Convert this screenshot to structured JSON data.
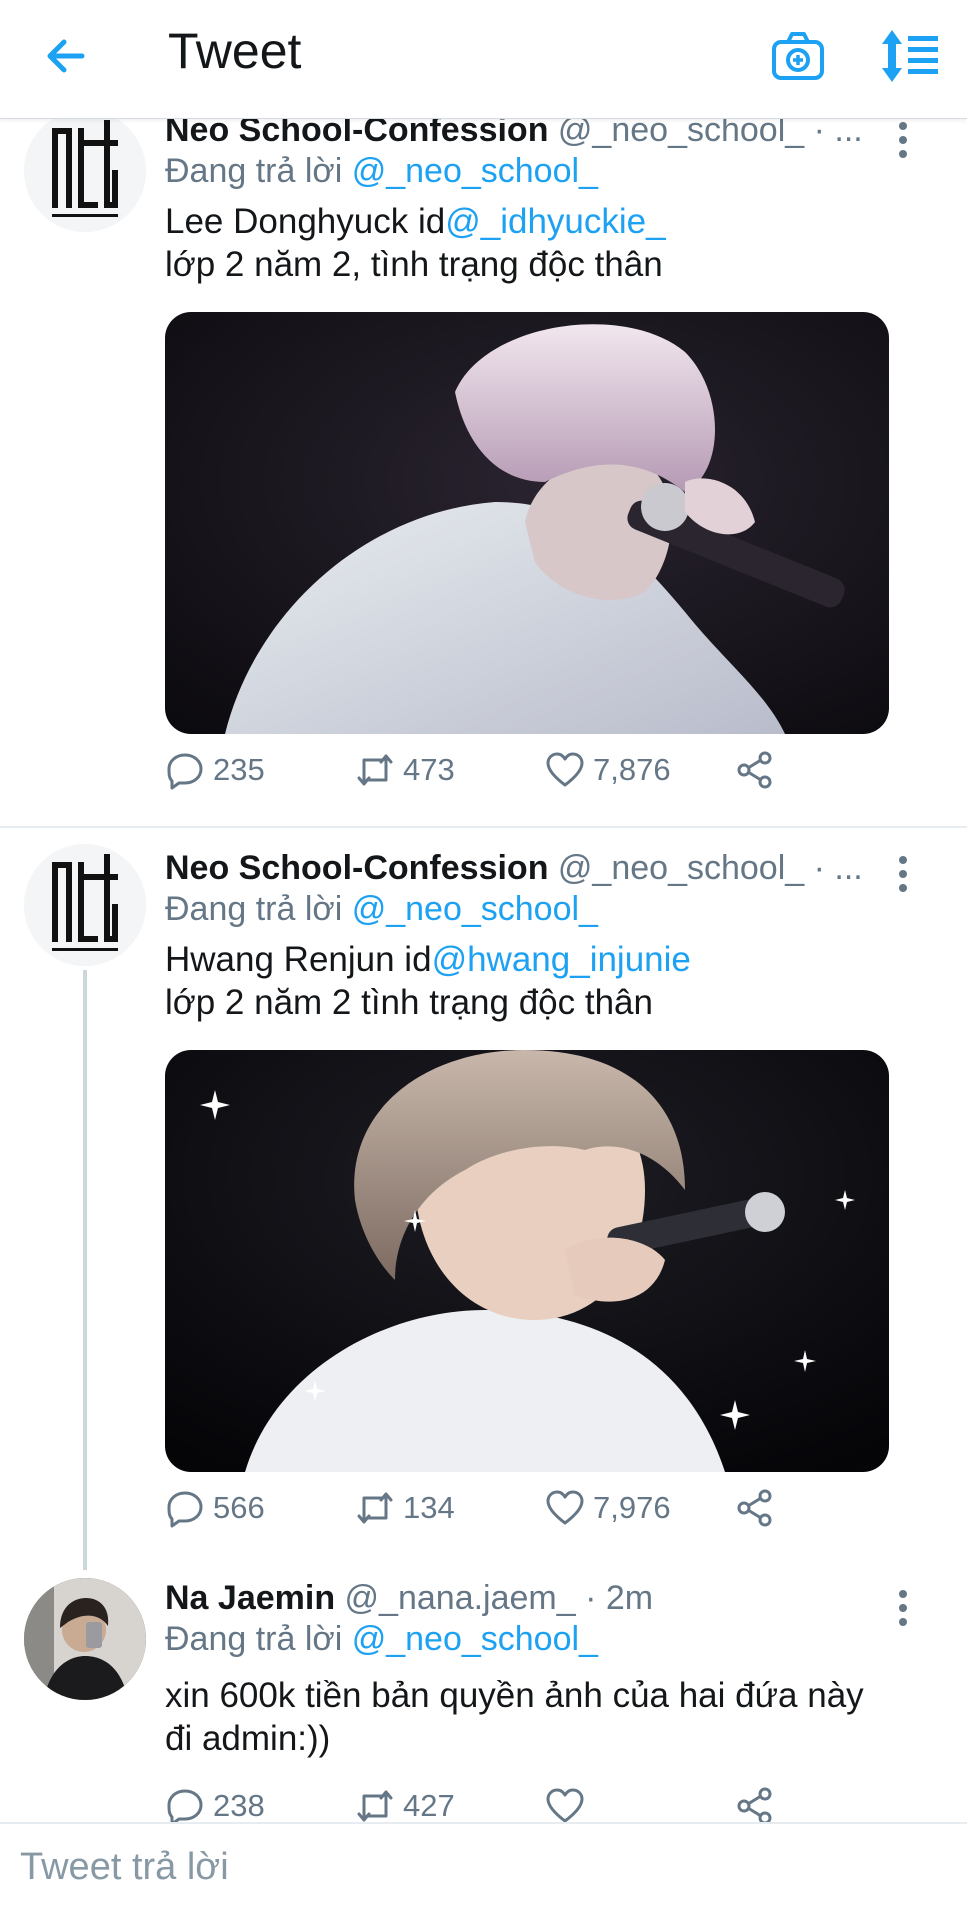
{
  "header": {
    "title": "Tweet",
    "back_icon": "arrow-left-icon",
    "camera_icon": "camera-plus-icon",
    "sort_icon": "sort-lines-icon",
    "accent_color": "#1da1f2"
  },
  "tweets": [
    {
      "display_name": "Neo School-Confession",
      "handle": "@_neo_school_ · ...",
      "reply_prefix": "Đang trả lời ",
      "reply_to": "@_neo_school_",
      "text_plain": "Lee Donghyuck id",
      "text_mention": "@_idhyuckie_",
      "text_line2": "lớp 2 năm 2, tình trạng độc thân",
      "replies": "235",
      "retweets": "473",
      "likes": "7,876"
    },
    {
      "display_name": "Neo School-Confession",
      "handle": "@_neo_school_ · ...",
      "reply_prefix": "Đang trả lời ",
      "reply_to": "@_neo_school_",
      "text_plain": "Hwang Renjun id",
      "text_mention": "@hwang_injunie",
      "text_line2": "lớp 2 năm 2 tình trạng độc thân",
      "replies": "566",
      "retweets": "134",
      "likes": "7,976"
    },
    {
      "display_name": "Na Jaemin",
      "handle": "@_nana.jaem_ · 2m",
      "reply_prefix": "Đang trả lời ",
      "reply_to": "@_neo_school_",
      "text_line1": "xin 600k tiền bản quyền ảnh của hai đứa này",
      "text_line2": "đi admin:))",
      "replies": "238",
      "retweets": "427"
    }
  ],
  "reply_bar": {
    "placeholder": "Tweet trả lời"
  }
}
